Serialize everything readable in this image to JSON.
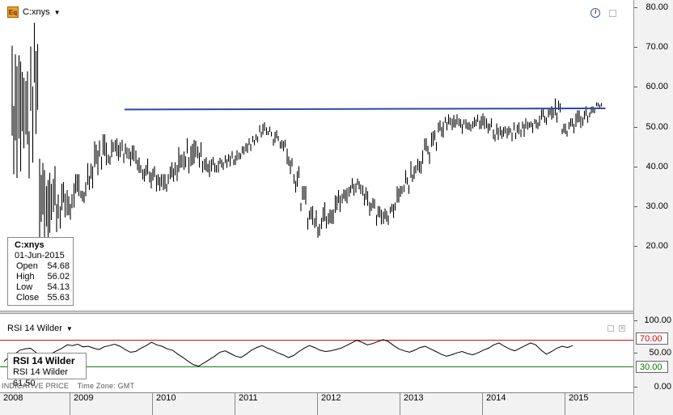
{
  "window": {
    "symbol": "C:xnys",
    "symbol_icon": "Eq",
    "dropdown_icon": "chevron-down-icon"
  },
  "info_box": {
    "symbol": "C:xnys",
    "date": "01-Jun-2015",
    "rows": [
      {
        "label": "Open",
        "value": "54.68"
      },
      {
        "label": "High",
        "value": "56.02"
      },
      {
        "label": "Low",
        "value": "54.13"
      },
      {
        "label": "Close",
        "value": "55.63"
      }
    ]
  },
  "rsi": {
    "title": "RSI 14 Wilder",
    "box_title": "RSI 14 Wilder",
    "box_label": "RSI 14 Wilder",
    "box_value": "61.50",
    "upper_level": "70.00",
    "lower_level": "30.00",
    "upper_color": "#cc0000",
    "lower_color": "#007a00"
  },
  "footer": {
    "indicative": "INDICATIVE PRICE",
    "timezone": "Time Zone: GMT"
  },
  "colors": {
    "price_bars": "#000000",
    "trendline": "#2a4aa8",
    "rsi_line": "#000000"
  },
  "chart_data": {
    "type": "bar",
    "x_axis": {
      "tick_labels": [
        "2008",
        "2009",
        "2010",
        "2011",
        "2012",
        "2013",
        "2014",
        "2015"
      ]
    },
    "price_axis": {
      "tick_labels": [
        "80.00",
        "70.00",
        "60.00",
        "50.00",
        "40.00",
        "30.00",
        "20.00"
      ],
      "range": [
        8,
        81
      ]
    },
    "rsi_axis": {
      "tick_labels": [
        "100.00",
        "50.00",
        "0.00"
      ],
      "range": [
        0,
        100
      ]
    },
    "price_series": {
      "points": [
        [
          "2008-05",
          35,
          78
        ],
        [
          "2008-06",
          31,
          76
        ],
        [
          "2008-07",
          33,
          70
        ],
        [
          "2008-08",
          38,
          78
        ],
        [
          "2008-09",
          18,
          48
        ],
        [
          "2008-10",
          20,
          43
        ],
        [
          "2008-11",
          22,
          40
        ],
        [
          "2008-12",
          24,
          36
        ],
        [
          "2009-01",
          25,
          35
        ],
        [
          "2009-02",
          28,
          38
        ],
        [
          "2009-03",
          30,
          36
        ],
        [
          "2009-04",
          34,
          42
        ],
        [
          "2009-05",
          37,
          47
        ],
        [
          "2009-06",
          39,
          48
        ],
        [
          "2009-07",
          40,
          47
        ],
        [
          "2009-08",
          41,
          50
        ],
        [
          "2009-09",
          40,
          48
        ],
        [
          "2009-10",
          40,
          46
        ],
        [
          "2009-11",
          38,
          44
        ],
        [
          "2009-12",
          36,
          42
        ],
        [
          "2010-01",
          34,
          40
        ],
        [
          "2010-02",
          32,
          38
        ],
        [
          "2010-03",
          32,
          38
        ],
        [
          "2010-04",
          34,
          41
        ],
        [
          "2010-05",
          36,
          45
        ],
        [
          "2010-06",
          38,
          47
        ],
        [
          "2010-07",
          39,
          48
        ],
        [
          "2010-08",
          38,
          46
        ],
        [
          "2010-09",
          37,
          44
        ],
        [
          "2010-10",
          37,
          43
        ],
        [
          "2010-11",
          38,
          43
        ],
        [
          "2010-12",
          39,
          43
        ],
        [
          "2011-01",
          40,
          44
        ],
        [
          "2011-02",
          41,
          45
        ],
        [
          "2011-03",
          43,
          47
        ],
        [
          "2011-04",
          45,
          48
        ],
        [
          "2011-05",
          47,
          51
        ],
        [
          "2011-06",
          47,
          50
        ],
        [
          "2011-07",
          45,
          49
        ],
        [
          "2011-08",
          43,
          48
        ],
        [
          "2011-09",
          38,
          45
        ],
        [
          "2011-10",
          33,
          40
        ],
        [
          "2011-11",
          28,
          35
        ],
        [
          "2011-12",
          24,
          31
        ],
        [
          "2012-01",
          22,
          29
        ],
        [
          "2012-02",
          24,
          31
        ],
        [
          "2012-03",
          25,
          33
        ],
        [
          "2012-04",
          27,
          34
        ],
        [
          "2012-05",
          29,
          35
        ],
        [
          "2012-06",
          32,
          37
        ],
        [
          "2012-07",
          33,
          38
        ],
        [
          "2012-08",
          30,
          36
        ],
        [
          "2012-09",
          26,
          32
        ],
        [
          "2012-10",
          24,
          30
        ],
        [
          "2012-11",
          25,
          30
        ],
        [
          "2012-12",
          27,
          32
        ],
        [
          "2013-01",
          30,
          36
        ],
        [
          "2013-02",
          33,
          39
        ],
        [
          "2013-03",
          36,
          42
        ],
        [
          "2013-04",
          38,
          44
        ],
        [
          "2013-05",
          40,
          47
        ],
        [
          "2013-06",
          43,
          49
        ],
        [
          "2013-07",
          46,
          52
        ],
        [
          "2013-08",
          48,
          53
        ],
        [
          "2013-09",
          48,
          53
        ],
        [
          "2013-10",
          48,
          52
        ],
        [
          "2013-11",
          48,
          53
        ],
        [
          "2013-12",
          49,
          54
        ],
        [
          "2014-01",
          49,
          55
        ],
        [
          "2014-02",
          47,
          52
        ],
        [
          "2014-03",
          46,
          51
        ],
        [
          "2014-04",
          46,
          50
        ],
        [
          "2014-05",
          46,
          50
        ],
        [
          "2014-06",
          46,
          51
        ],
        [
          "2014-07",
          47,
          52
        ],
        [
          "2014-08",
          48,
          52
        ],
        [
          "2014-09",
          49,
          53
        ],
        [
          "2014-10",
          50,
          55
        ],
        [
          "2014-11",
          51,
          56
        ],
        [
          "2014-12",
          50,
          57
        ],
        [
          "2015-01",
          47,
          51
        ],
        [
          "2015-02",
          48,
          52
        ],
        [
          "2015-03",
          49,
          54
        ],
        [
          "2015-04",
          50,
          55
        ],
        [
          "2015-05",
          52,
          55
        ],
        [
          "2015-06",
          54,
          56
        ]
      ]
    },
    "trendline": {
      "start": [
        "2009-09",
        54.2
      ],
      "end": [
        "2015-06",
        54.5
      ]
    },
    "rsi_series": {
      "values": [
        38,
        45,
        49,
        55,
        57,
        58,
        52,
        46,
        48,
        50,
        54,
        58,
        63,
        62,
        64,
        60,
        61,
        58,
        56,
        60,
        62,
        64,
        61,
        56,
        52,
        53,
        58,
        62,
        67,
        63,
        61,
        57,
        55,
        49,
        44,
        38,
        33,
        31,
        36,
        41,
        46,
        52,
        54,
        50,
        46,
        44,
        49,
        55,
        59,
        62,
        58,
        55,
        51,
        48,
        44,
        47,
        53,
        58,
        62,
        59,
        55,
        53,
        54,
        56,
        58,
        62,
        66,
        70,
        67,
        63,
        65,
        68,
        71,
        68,
        62,
        57,
        54,
        52,
        55,
        59,
        61,
        57,
        53,
        49,
        46,
        48,
        51,
        53,
        50,
        48,
        51,
        55,
        58,
        63,
        66,
        61,
        57,
        54,
        58,
        62,
        66,
        63,
        55,
        49,
        53,
        58,
        61,
        59,
        62
      ]
    }
  }
}
